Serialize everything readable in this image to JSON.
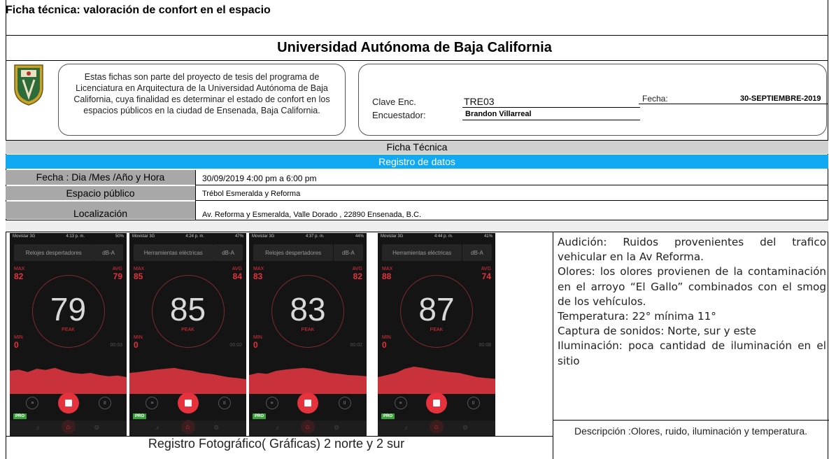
{
  "header": {
    "doc_title": "Ficha técnica: valoración de confort en el espacio",
    "university": "Universidad Autónoma de Baja California"
  },
  "intro_text": "Estas fichas son parte del proyecto de tesis del programa de Licenciatura en Arquitectura de la Universidad Autónoma de Baja California, cuya finalidad es determinar el estado de confort en los espacios públicos en la ciudad de Ensenada, Baja California.",
  "meta": {
    "clave_label": "Clave Enc.",
    "clave_value": "TRE03",
    "encuestador_label": "Encuestador:",
    "encuestador_value": "Brandon Villarreal",
    "fecha_label": "Fecha:",
    "fecha_value": "30-SEPTIEMBRE-2019"
  },
  "bars": {
    "ficha": "Ficha Técnica",
    "registro": "Registro de datos"
  },
  "rows": [
    {
      "label": "Fecha : Dia /Mes /Año  y Hora",
      "value": "30/09/2019 4:00 pm a 6:00 pm"
    },
    {
      "label": "Espacio público",
      "value": "Trébol Esmeralda y Reforma"
    },
    {
      "label": "Localización",
      "value": "Av. Reforma y Esmeralda, Valle Dorado , 22890 Ensenada, B.C."
    }
  ],
  "phones": [
    {
      "carrier": "Movistar  3G",
      "time": "4:13 p. m.",
      "battery": "50%",
      "mode": "Relojes despertadores",
      "unit": "dB-A",
      "max_label": "MAX",
      "max": "82",
      "avg_label": "AVG",
      "avg": "79",
      "reading": "79",
      "peak": "PEAK",
      "min_label": "MIN",
      "min": "0",
      "timer": "00:03",
      "pro": "PRO"
    },
    {
      "carrier": "Movistar  3G",
      "time": "4:24 p. m.",
      "battery": "47%",
      "mode": "Herramientas eléctricas",
      "unit": "dB-A",
      "max_label": "MAX",
      "max": "85",
      "avg_label": "AVG",
      "avg": "84",
      "reading": "85",
      "peak": "PEAK",
      "min_label": "MIN",
      "min": "0",
      "timer": "00:02",
      "pro": "PRO"
    },
    {
      "carrier": "Movistar  3G",
      "time": "4:37 p. m.",
      "battery": "44%",
      "mode": "Relojes despertadores",
      "unit": "dB-A",
      "max_label": "MAX",
      "max": "83",
      "avg_label": "AVG",
      "avg": "82",
      "reading": "83",
      "peak": "PEAK",
      "min_label": "MIN",
      "min": "0",
      "timer": "00:02",
      "pro": "PRO"
    },
    {
      "carrier": "Movistar  3G",
      "time": "4:44 p. m.",
      "battery": "41%",
      "mode": "Herramientas eléctricas",
      "unit": "dB-A",
      "max_label": "MAX",
      "max": "88",
      "avg_label": "AVG",
      "avg": "74",
      "reading": "87",
      "peak": "PEAK",
      "min_label": "MIN",
      "min": "0",
      "timer": "00:08",
      "pro": "PRO"
    }
  ],
  "notes": {
    "audicion": "Audición:  Ruidos  provenientes  del trafico vehicular en la Av Reforma.",
    "olores": "Olores:  los olores provienen de la contaminación en el arroyo “El Gallo” combinados  con  el  smog  de  los vehículos.",
    "temperatura": "Temperatura: 22° mínima 11°",
    "captura": "Captura de sonidos: Norte, sur y este",
    "iluminacion": "Iluminación:    poca    cantidad    de iluminación en el sitio"
  },
  "descripcion": "Descripción :Olores, ruido, iluminación y temperatura.",
  "foto_caption": "Registro Fotográfico( Gráficas) 2 norte y 2 sur",
  "colors": {
    "accent_blue": "#11aaf2",
    "row_label_grey": "#a8a8a8",
    "bar_grey": "#d0d0d0",
    "app_red": "#e5323c"
  }
}
